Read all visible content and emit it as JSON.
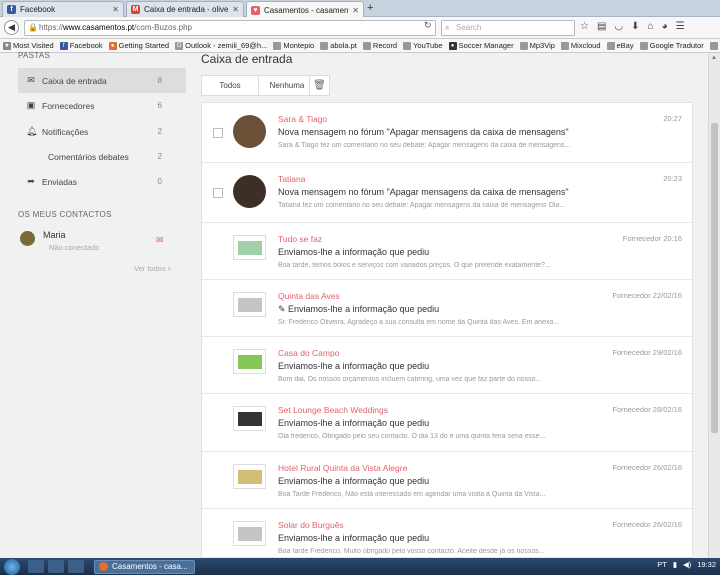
{
  "browser": {
    "tabs": [
      {
        "label": "Facebook",
        "icon": "facebook-icon",
        "color": "#3b5998",
        "glyph": "f",
        "active": false
      },
      {
        "label": "Caixa de entrada - oliveira.f...",
        "icon": "gmail-icon",
        "color": "#d44638",
        "glyph": "M",
        "active": false
      },
      {
        "label": "Casamentos - casamentos....",
        "icon": "casamentos-icon",
        "color": "#e2626d",
        "glyph": "♥",
        "active": true
      }
    ],
    "new_tab": "+",
    "url_host": "www.casamentos.pt",
    "url_path": "/com-Buzos.php",
    "url_prefix": "https://",
    "search_placeholder": "Search",
    "bookmarks": [
      {
        "label": "Most Visited",
        "color": "#888",
        "glyph": "★"
      },
      {
        "label": "Facebook",
        "color": "#3b5998",
        "glyph": "f"
      },
      {
        "label": "Getting Started",
        "color": "#e76e2a",
        "glyph": "●"
      },
      {
        "label": "Outlook - zemili_69@h...",
        "color": "#999",
        "glyph": "O"
      },
      {
        "label": "Montepio",
        "color": "#999",
        "glyph": ""
      },
      {
        "label": "abola.pt",
        "color": "#999",
        "glyph": ""
      },
      {
        "label": "Record",
        "color": "#999",
        "glyph": ""
      },
      {
        "label": "YouTube",
        "color": "#999",
        "glyph": ""
      },
      {
        "label": "Soccer Manager",
        "color": "#333",
        "glyph": "●"
      },
      {
        "label": "Mp3Vip",
        "color": "#999",
        "glyph": ""
      },
      {
        "label": "Mixcloud",
        "color": "#999",
        "glyph": ""
      },
      {
        "label": "eBay",
        "color": "#999",
        "glyph": ""
      },
      {
        "label": "Google Tradutor",
        "color": "#999",
        "glyph": ""
      },
      {
        "label": "LivingElectro",
        "color": "#999",
        "glyph": ""
      }
    ]
  },
  "sidebar": {
    "section_folders": "PASTAS",
    "items": [
      {
        "label": "Caixa de entrada",
        "count": "8",
        "icon": "envelope-icon",
        "glyph": "✉",
        "selected": true
      },
      {
        "label": "Fornecedores",
        "count": "6",
        "icon": "briefcase-icon",
        "glyph": "▣",
        "selected": false
      },
      {
        "label": "Notificações",
        "count": "2",
        "icon": "bell-icon",
        "glyph": "♫",
        "selected": false
      },
      {
        "label": "Comentários debates",
        "count": "2",
        "icon": "",
        "glyph": "",
        "selected": false
      },
      {
        "label": "Enviadas",
        "count": "0",
        "icon": "share-arrow-icon",
        "glyph": "➦",
        "selected": false
      }
    ],
    "section_contacts": "OS MEUS CONTACTOS",
    "contact": {
      "name": "Maria",
      "status": "Não conectado"
    },
    "see_all": "Ver todos"
  },
  "main": {
    "title": "Caixa de entrada",
    "filters": [
      "Todos",
      "Nenhuma"
    ],
    "messages": [
      {
        "name": "Sara & Tiago",
        "subject": "Nova mensagem no fórum \"Apagar mensagens da caixa de mensagens\"",
        "preview": "Sara & Tiago fez um comentário no seu debate: Apagar mensagens da caixa de mensagens...",
        "time": "20:27",
        "kind": "avatar",
        "color": "#6b4f36"
      },
      {
        "name": "Tatiana",
        "subject": "Nova mensagem no fórum \"Apagar mensagens da caixa de mensagens\"",
        "preview": "Tatiana fez um comentário no seu debate: Apagar mensagens da caixa de mensagens Ola...",
        "time": "20:23",
        "kind": "avatar",
        "color": "#3d2f27"
      },
      {
        "name": "Tudo se faz",
        "subject": "Enviamos-lhe a informação que pediu",
        "preview": "Boa tarde, temos bolos e serviços com variados preços. O que pretende exatamente?...",
        "time": "Fornecedor 20:16",
        "kind": "logo",
        "color": "#8fc89a"
      },
      {
        "name": "Quinta das Aves",
        "subject": "✎ Enviamos-lhe a informação que pediu",
        "preview": "Sr. Frederico Oliveira, Agradeço a sua consulta em nome da Quinta das Aves. Em anexo...",
        "time": "Fornecedor 22/02/16",
        "kind": "logo",
        "color": "#bbb"
      },
      {
        "name": "Casa do Campo",
        "subject": "Enviamos-lhe a informação que pediu",
        "preview": "Bom dia, Os nossos orçamentos incluem catering, uma vez que faz parte do nosso...",
        "time": "Fornecedor 29/02/16",
        "kind": "logo",
        "color": "#6fbf3a"
      },
      {
        "name": "Set Lounge Beach Weddings",
        "subject": "Enviamos-lhe a informação que pediu",
        "preview": "Ola frederico, Obrigado pelo seu contacto. O dia 13 do é uma quinta feira seria esse...",
        "time": "Fornecedor 28/02/16",
        "kind": "logo",
        "color": "#111"
      },
      {
        "name": "Hotel Rural Quinta da Vista Alegre",
        "subject": "Enviamos-lhe a informação que pediu",
        "preview": "Boa Tarde Frederico, Não está interessado em agendar uma visita à Quinta da Vista...",
        "time": "Fornecedor 26/02/16",
        "kind": "logo",
        "color": "#c9b25a"
      },
      {
        "name": "Solar do Burguês",
        "subject": "Enviamos-lhe a informação que pediu",
        "preview": "Boa tarde Frederico. Muito obrigado pelo vosso contacto. Aceite desde já os nossos...",
        "time": "Fornecedor 26/02/16",
        "kind": "logo",
        "color": "#bbb"
      }
    ]
  },
  "taskbar": {
    "task_label": "Casamentos - casa...",
    "lang": "PT",
    "clock": "19:32"
  }
}
